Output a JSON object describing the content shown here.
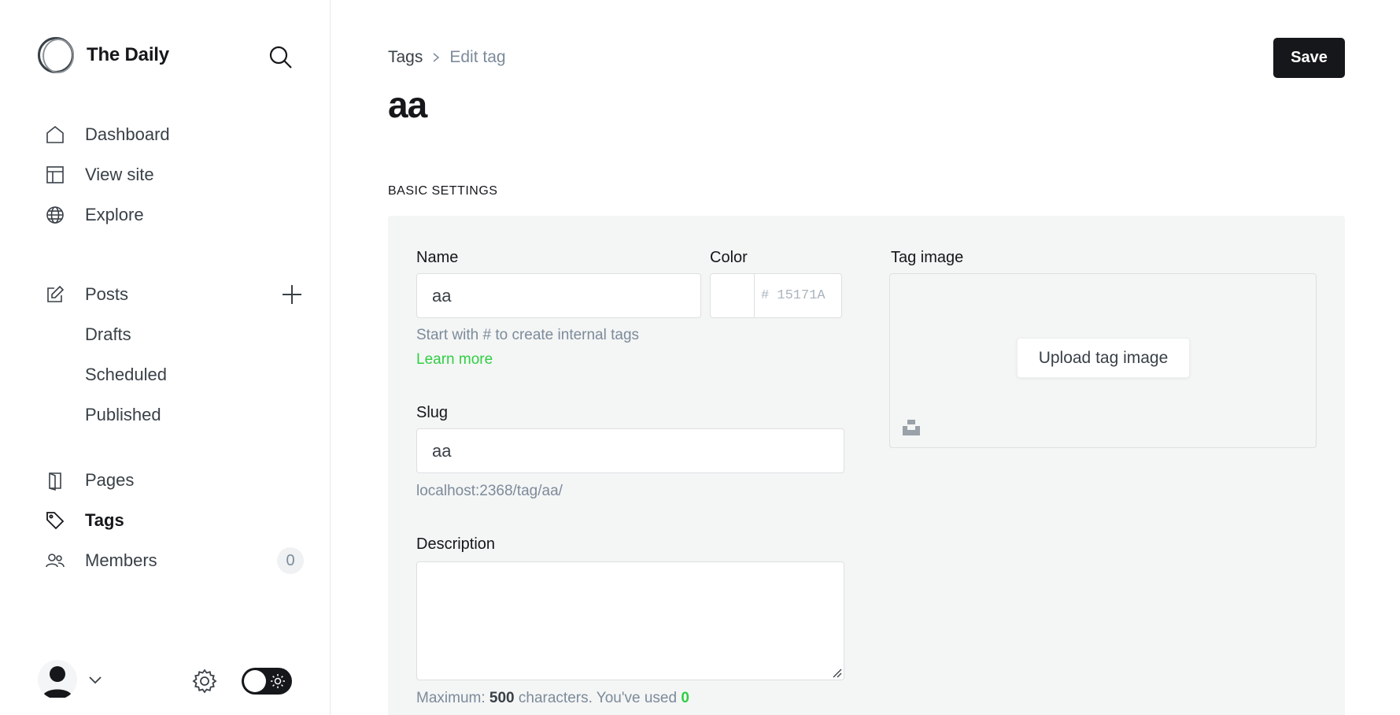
{
  "brand": {
    "title": "The Daily"
  },
  "nav": {
    "primary": [
      {
        "label": "Dashboard",
        "icon": "home-icon"
      },
      {
        "label": "View site",
        "icon": "layout-icon"
      },
      {
        "label": "Explore",
        "icon": "globe-icon"
      }
    ],
    "posts": {
      "label": "Posts",
      "icon": "edit-icon",
      "add_icon": "plus-icon"
    },
    "posts_sub": [
      {
        "label": "Drafts"
      },
      {
        "label": "Scheduled"
      },
      {
        "label": "Published"
      }
    ],
    "secondary": [
      {
        "label": "Pages",
        "icon": "page-icon"
      },
      {
        "label": "Tags",
        "icon": "tag-icon",
        "active": true
      },
      {
        "label": "Members",
        "icon": "members-icon",
        "badge": "0"
      }
    ]
  },
  "header": {
    "breadcrumb_parent": "Tags",
    "breadcrumb_current": "Edit tag",
    "title": "aa",
    "save_label": "Save"
  },
  "section": {
    "label": "BASIC SETTINGS"
  },
  "form": {
    "name_label": "Name",
    "name_value": "aa",
    "name_hint": "Start with # to create internal tags",
    "learn_more": "Learn more",
    "color_label": "Color",
    "color_hash": "#",
    "color_placeholder": "15171A",
    "slug_label": "Slug",
    "slug_value": "aa",
    "slug_url": "localhost:2368/tag/aa/",
    "description_label": "Description",
    "description_value": "",
    "desc_max_prefix": "Maximum:",
    "desc_max_value": "500",
    "desc_max_suffix": "characters. You've used",
    "desc_used": "0",
    "tag_image_label": "Tag image",
    "upload_label": "Upload tag image"
  },
  "colors": {
    "accent_green": "#30cf43",
    "primary_dark": "#15171a",
    "panel_bg": "#f4f5f5"
  }
}
